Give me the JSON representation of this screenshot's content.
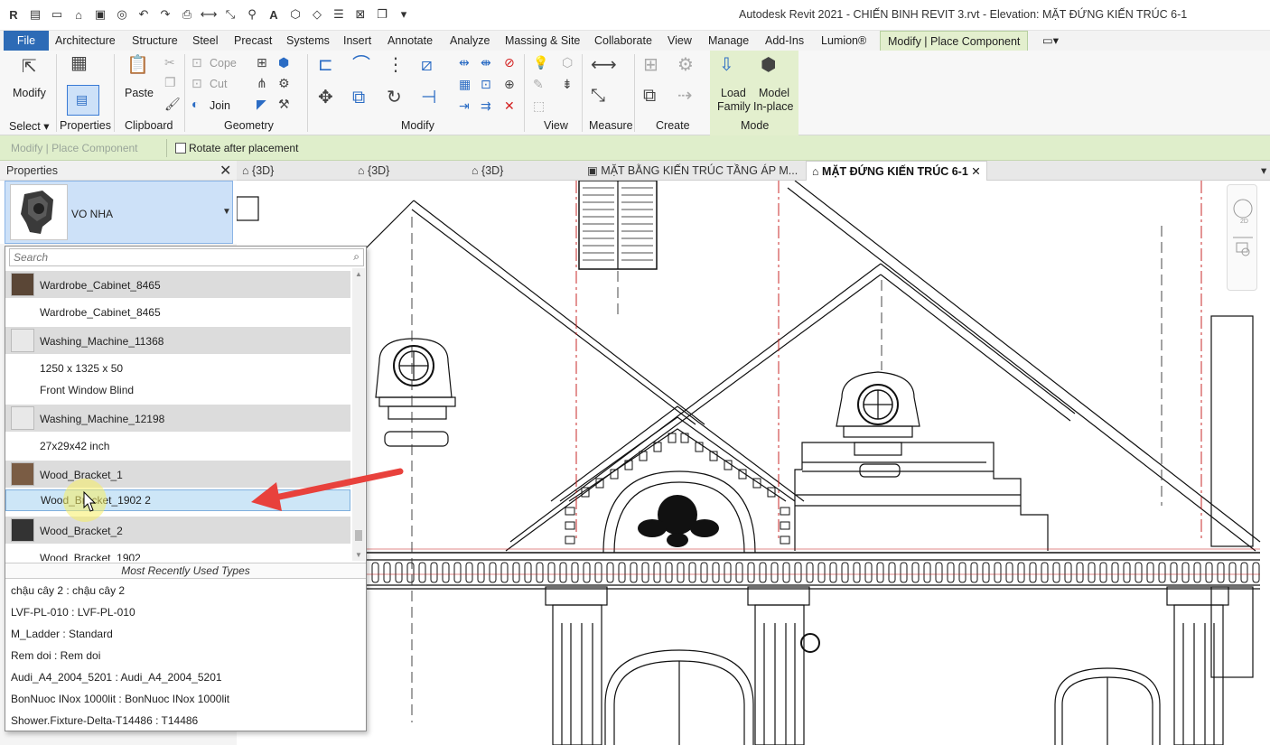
{
  "app": {
    "title": "Autodesk Revit 2021 - CHIẾN BINH REVIT 3.rvt - Elevation: MẶT ĐỨNG KIẾN TRÚC 6-1",
    "logo": "R"
  },
  "ribbon_tabs": [
    "File",
    "Architecture",
    "Structure",
    "Steel",
    "Precast",
    "Systems",
    "Insert",
    "Annotate",
    "Analyze",
    "Massing & Site",
    "Collaborate",
    "View",
    "Manage",
    "Add-Ins",
    "Lumion®",
    "Modify | Place Component"
  ],
  "ribbon": {
    "modify": "Modify",
    "select": "Select",
    "properties": "Properties",
    "paste": "Paste",
    "clipboard": "Clipboard",
    "cope": "Cope",
    "cut": "Cut",
    "join": "Join",
    "geometry": "Geometry",
    "modify_panel": "Modify",
    "view": "View",
    "measure": "Measure",
    "create": "Create",
    "load_family_1": "Load",
    "load_family_2": "Family",
    "model_inplace_1": "Model",
    "model_inplace_2": "In-place",
    "mode": "Mode"
  },
  "options_bar": {
    "mode_label": "Modify | Place Component",
    "rotate_label": "Rotate after placement"
  },
  "properties": {
    "title": "Properties",
    "type_name": "VO NHA",
    "search_placeholder": "Search",
    "list": [
      {
        "kind": "family",
        "name": "Wardrobe_Cabinet_8465"
      },
      {
        "kind": "type",
        "name": "Wardrobe_Cabinet_8465"
      },
      {
        "kind": "family",
        "name": "Washing_Machine_11368"
      },
      {
        "kind": "type",
        "name": "1250 x 1325 x 50"
      },
      {
        "kind": "type",
        "name": "Front Window Blind"
      },
      {
        "kind": "family",
        "name": "Washing_Machine_12198"
      },
      {
        "kind": "type",
        "name": "27x29x42 inch"
      },
      {
        "kind": "family",
        "name": "Wood_Bracket_1"
      },
      {
        "kind": "type",
        "name": "Wood_Bracket_1902 2",
        "selected": true
      },
      {
        "kind": "family",
        "name": "Wood_Bracket_2"
      },
      {
        "kind": "type",
        "name": "Wood_Bracket_1902"
      }
    ],
    "mru_title": "Most Recently Used Types",
    "mru": [
      "chậu cây 2 : chậu cây 2",
      "LVF-PL-010 : LVF-PL-010",
      "M_Ladder : Standard",
      "Rem doi : Rem doi",
      "Audi_A4_2004_5201 : Audi_A4_2004_5201",
      "BonNuoc INox 1000lit : BonNuoc INox 1000lit",
      "Shower.Fixture-Delta-T14486 : T14486"
    ]
  },
  "view_tabs": [
    "{3D}",
    "{3D}",
    "{3D}",
    "MẶT BẰNG KIẾN TRÚC TẦNG ÁP M...",
    "MẶT ĐỨNG KIẾN TRÚC 6-1"
  ],
  "colors": {
    "accent": "#2d6bb6",
    "context_tab": "#e3efce",
    "selection": "#cde6f7",
    "arrow": "#e8413c"
  }
}
